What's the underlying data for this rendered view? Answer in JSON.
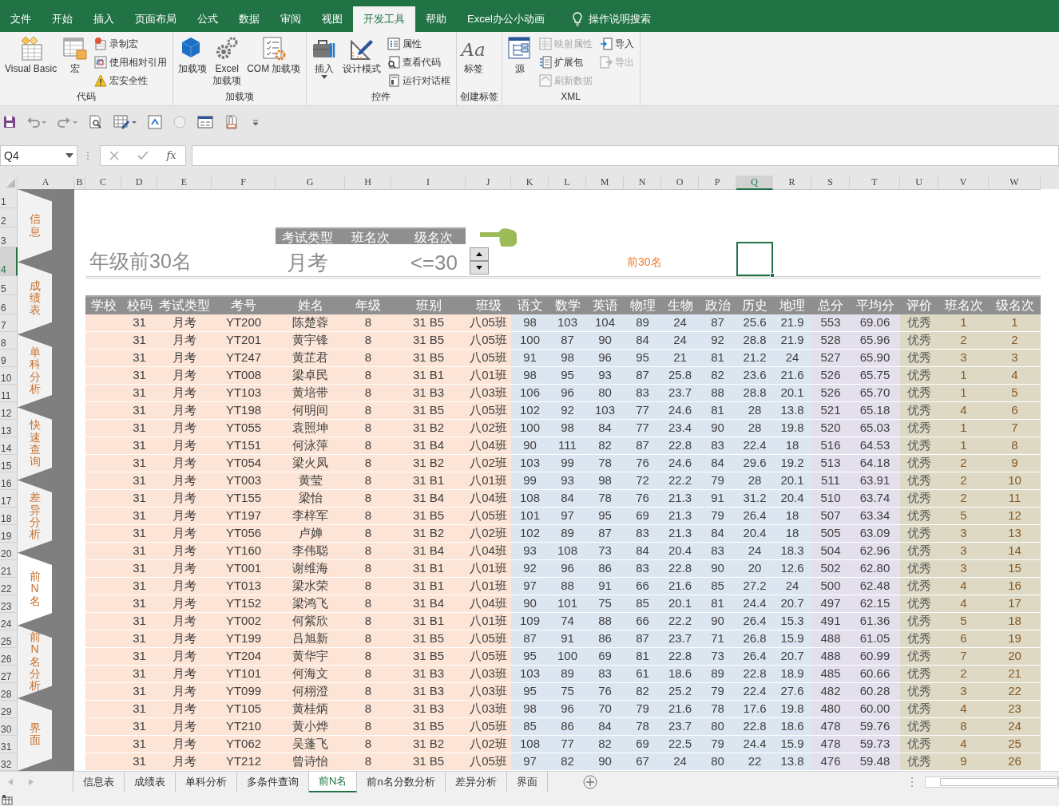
{
  "menu_tabs": [
    {
      "label": "文件",
      "selected": false
    },
    {
      "label": "开始",
      "selected": false
    },
    {
      "label": "插入",
      "selected": false
    },
    {
      "label": "页面布局",
      "selected": false
    },
    {
      "label": "公式",
      "selected": false
    },
    {
      "label": "数据",
      "selected": false
    },
    {
      "label": "审阅",
      "selected": false
    },
    {
      "label": "视图",
      "selected": false
    },
    {
      "label": "开发工具",
      "selected": true
    },
    {
      "label": "帮助",
      "selected": false
    },
    {
      "label": "Excel办公小动画",
      "selected": false
    }
  ],
  "tell_me": "操作说明搜索",
  "ribbon_groups": [
    {
      "title": "代码",
      "buttons": [
        {
          "label": "Visual Basic",
          "kind": "large",
          "disabled": false
        },
        {
          "label": "宏",
          "kind": "large",
          "disabled": false
        },
        {
          "label": "录制宏",
          "kind": "small",
          "disabled": false
        },
        {
          "label": "使用相对引用",
          "kind": "small",
          "disabled": false
        },
        {
          "label": "宏安全性",
          "kind": "small",
          "disabled": false
        }
      ]
    },
    {
      "title": "加载项",
      "buttons": [
        {
          "label": "加载项",
          "kind": "large",
          "disabled": false
        },
        {
          "label": "Excel\n加载项",
          "kind": "large",
          "disabled": false
        },
        {
          "label": "COM 加载项",
          "kind": "large",
          "disabled": false
        }
      ]
    },
    {
      "title": "控件",
      "buttons": [
        {
          "label": "插入",
          "kind": "large-menu",
          "disabled": false
        },
        {
          "label": "设计模式",
          "kind": "large",
          "disabled": false
        },
        {
          "label": "属性",
          "kind": "small",
          "disabled": false
        },
        {
          "label": "查看代码",
          "kind": "small",
          "disabled": false
        },
        {
          "label": "运行对话框",
          "kind": "small",
          "disabled": false
        }
      ]
    },
    {
      "title": "创建标签",
      "buttons": [
        {
          "label": "标签",
          "kind": "large",
          "glyph": "Aa",
          "disabled": false
        }
      ]
    },
    {
      "title": "XML",
      "buttons": [
        {
          "label": "源",
          "kind": "large",
          "disabled": false
        },
        {
          "label": "映射属性",
          "kind": "small",
          "disabled": true
        },
        {
          "label": "扩展包",
          "kind": "small",
          "disabled": false
        },
        {
          "label": "刷新数据",
          "kind": "small",
          "disabled": true
        },
        {
          "label": "导入",
          "kind": "small",
          "disabled": false
        },
        {
          "label": "导出",
          "kind": "small",
          "disabled": true
        }
      ]
    }
  ],
  "formula_bar": {
    "name_box": "Q4",
    "fx": "fx"
  },
  "columns": [
    {
      "label": "A",
      "selected": false
    },
    {
      "label": "B",
      "selected": false
    },
    {
      "label": "C",
      "selected": false
    },
    {
      "label": "D",
      "selected": false
    },
    {
      "label": "E",
      "selected": false
    },
    {
      "label": "F",
      "selected": false
    },
    {
      "label": "G",
      "selected": false
    },
    {
      "label": "H",
      "selected": false
    },
    {
      "label": "I",
      "selected": false
    },
    {
      "label": "J",
      "selected": false
    },
    {
      "label": "K",
      "selected": false
    },
    {
      "label": "L",
      "selected": false
    },
    {
      "label": "M",
      "selected": false
    },
    {
      "label": "N",
      "selected": false
    },
    {
      "label": "O",
      "selected": false
    },
    {
      "label": "P",
      "selected": false
    },
    {
      "label": "Q",
      "selected": true
    },
    {
      "label": "R",
      "selected": false
    },
    {
      "label": "S",
      "selected": false
    },
    {
      "label": "T",
      "selected": false
    },
    {
      "label": "U",
      "selected": false
    },
    {
      "label": "V",
      "selected": false
    },
    {
      "label": "W",
      "selected": false
    }
  ],
  "row_numbers": [
    {
      "label": "1",
      "selected": false
    },
    {
      "label": "2",
      "selected": false
    },
    {
      "label": "3",
      "selected": false
    },
    {
      "label": "4",
      "selected": true
    },
    {
      "label": "5",
      "selected": false
    },
    {
      "label": "6",
      "selected": false
    },
    {
      "label": "7",
      "selected": false
    },
    {
      "label": "8",
      "selected": false
    },
    {
      "label": "9",
      "selected": false
    },
    {
      "label": "10",
      "selected": false
    },
    {
      "label": "11",
      "selected": false
    },
    {
      "label": "12",
      "selected": false
    },
    {
      "label": "13",
      "selected": false
    },
    {
      "label": "14",
      "selected": false
    },
    {
      "label": "15",
      "selected": false
    },
    {
      "label": "16",
      "selected": false
    },
    {
      "label": "17",
      "selected": false
    },
    {
      "label": "18",
      "selected": false
    },
    {
      "label": "19",
      "selected": false
    },
    {
      "label": "20",
      "selected": false
    },
    {
      "label": "21",
      "selected": false
    },
    {
      "label": "22",
      "selected": false
    },
    {
      "label": "23",
      "selected": false
    },
    {
      "label": "24",
      "selected": false
    },
    {
      "label": "25",
      "selected": false
    },
    {
      "label": "26",
      "selected": false
    },
    {
      "label": "27",
      "selected": false
    },
    {
      "label": "28",
      "selected": false
    },
    {
      "label": "29",
      "selected": false
    },
    {
      "label": "30",
      "selected": false
    },
    {
      "label": "31",
      "selected": false
    },
    {
      "label": "32",
      "selected": false
    }
  ],
  "side_nav": [
    {
      "label": "信息",
      "selected": false
    },
    {
      "label": "成绩表",
      "selected": false
    },
    {
      "label": "单科分析",
      "selected": false
    },
    {
      "label": "快速查询",
      "selected": false
    },
    {
      "label": "差异分析",
      "selected": false
    },
    {
      "label": "前N名",
      "selected": true
    },
    {
      "label": "前N名分析",
      "selected": false
    },
    {
      "label": "界面",
      "selected": false
    }
  ],
  "panel": {
    "title": "年级前30名",
    "criteria": [
      {
        "header": "考试类型",
        "value": "月考"
      },
      {
        "header": "班名次"
      },
      {
        "header": "级名次",
        "value": "<=30"
      }
    ],
    "result": "前30名"
  },
  "table": {
    "columns": [
      "学校",
      "校码",
      "考试类型",
      "考号",
      "姓名",
      "年级",
      "班别",
      "班级",
      "语文",
      "数学",
      "英语",
      "物理",
      "生物",
      "政治",
      "历史",
      "地理",
      "总分",
      "平均分",
      "评价",
      "班名次",
      "级名次"
    ],
    "rows": [
      [
        "",
        "31",
        "月考",
        "YT200",
        "陈楚蓉",
        "8",
        "31 B5",
        "八05班",
        "98",
        "103",
        "104",
        "89",
        "24",
        "87",
        "25.6",
        "21.9",
        "553",
        "69.06",
        "优秀",
        "1",
        "1"
      ],
      [
        "",
        "31",
        "月考",
        "YT201",
        "黄宇锋",
        "8",
        "31 B5",
        "八05班",
        "100",
        "87",
        "90",
        "84",
        "24",
        "92",
        "28.8",
        "21.9",
        "528",
        "65.96",
        "优秀",
        "2",
        "2"
      ],
      [
        "",
        "31",
        "月考",
        "YT247",
        "黄芷君",
        "8",
        "31 B5",
        "八05班",
        "91",
        "98",
        "96",
        "95",
        "21",
        "81",
        "21.2",
        "24",
        "527",
        "65.90",
        "优秀",
        "3",
        "3"
      ],
      [
        "",
        "31",
        "月考",
        "YT008",
        "梁卓民",
        "8",
        "31 B1",
        "八01班",
        "98",
        "95",
        "93",
        "87",
        "25.8",
        "82",
        "23.6",
        "21.6",
        "526",
        "65.75",
        "优秀",
        "1",
        "4"
      ],
      [
        "",
        "31",
        "月考",
        "YT103",
        "黄培带",
        "8",
        "31 B3",
        "八03班",
        "106",
        "96",
        "80",
        "83",
        "23.7",
        "88",
        "28.8",
        "20.1",
        "526",
        "65.70",
        "优秀",
        "1",
        "5"
      ],
      [
        "",
        "31",
        "月考",
        "YT198",
        "何明间",
        "8",
        "31 B5",
        "八05班",
        "102",
        "92",
        "103",
        "77",
        "24.6",
        "81",
        "28",
        "13.8",
        "521",
        "65.18",
        "优秀",
        "4",
        "6"
      ],
      [
        "",
        "31",
        "月考",
        "YT055",
        "袁照坤",
        "8",
        "31 B2",
        "八02班",
        "100",
        "98",
        "84",
        "77",
        "23.4",
        "90",
        "28",
        "19.8",
        "520",
        "65.03",
        "优秀",
        "1",
        "7"
      ],
      [
        "",
        "31",
        "月考",
        "YT151",
        "何泳萍",
        "8",
        "31 B4",
        "八04班",
        "90",
        "111",
        "82",
        "87",
        "22.8",
        "83",
        "22.4",
        "18",
        "516",
        "64.53",
        "优秀",
        "1",
        "8"
      ],
      [
        "",
        "31",
        "月考",
        "YT054",
        "梁火凤",
        "8",
        "31 B2",
        "八02班",
        "103",
        "99",
        "78",
        "76",
        "24.6",
        "84",
        "29.6",
        "19.2",
        "513",
        "64.18",
        "优秀",
        "2",
        "9"
      ],
      [
        "",
        "31",
        "月考",
        "YT003",
        "黄莹",
        "8",
        "31 B1",
        "八01班",
        "99",
        "93",
        "98",
        "72",
        "22.2",
        "79",
        "28",
        "20.1",
        "511",
        "63.91",
        "优秀",
        "2",
        "10"
      ],
      [
        "",
        "31",
        "月考",
        "YT155",
        "梁怡",
        "8",
        "31 B4",
        "八04班",
        "108",
        "84",
        "78",
        "76",
        "21.3",
        "91",
        "31.2",
        "20.4",
        "510",
        "63.74",
        "优秀",
        "2",
        "11"
      ],
      [
        "",
        "31",
        "月考",
        "YT197",
        "李梓军",
        "8",
        "31 B5",
        "八05班",
        "101",
        "97",
        "95",
        "69",
        "21.3",
        "79",
        "26.4",
        "18",
        "507",
        "63.34",
        "优秀",
        "5",
        "12"
      ],
      [
        "",
        "31",
        "月考",
        "YT056",
        "卢婵",
        "8",
        "31 B2",
        "八02班",
        "102",
        "89",
        "87",
        "83",
        "21.3",
        "84",
        "20.4",
        "18",
        "505",
        "63.09",
        "优秀",
        "3",
        "13"
      ],
      [
        "",
        "31",
        "月考",
        "YT160",
        "李伟聪",
        "8",
        "31 B4",
        "八04班",
        "93",
        "108",
        "73",
        "84",
        "20.4",
        "83",
        "24",
        "18.3",
        "504",
        "62.96",
        "优秀",
        "3",
        "14"
      ],
      [
        "",
        "31",
        "月考",
        "YT001",
        "谢维海",
        "8",
        "31 B1",
        "八01班",
        "92",
        "96",
        "86",
        "83",
        "22.8",
        "90",
        "20",
        "12.6",
        "502",
        "62.80",
        "优秀",
        "3",
        "15"
      ],
      [
        "",
        "31",
        "月考",
        "YT013",
        "梁水荣",
        "8",
        "31 B1",
        "八01班",
        "97",
        "88",
        "91",
        "66",
        "21.6",
        "85",
        "27.2",
        "24",
        "500",
        "62.48",
        "优秀",
        "4",
        "16"
      ],
      [
        "",
        "31",
        "月考",
        "YT152",
        "梁鸿飞",
        "8",
        "31 B4",
        "八04班",
        "90",
        "101",
        "75",
        "85",
        "20.1",
        "81",
        "24.4",
        "20.7",
        "497",
        "62.15",
        "优秀",
        "4",
        "17"
      ],
      [
        "",
        "31",
        "月考",
        "YT002",
        "何紫欣",
        "8",
        "31 B1",
        "八01班",
        "109",
        "74",
        "88",
        "66",
        "22.2",
        "90",
        "26.4",
        "15.3",
        "491",
        "61.36",
        "优秀",
        "5",
        "18"
      ],
      [
        "",
        "31",
        "月考",
        "YT199",
        "吕旭新",
        "8",
        "31 B5",
        "八05班",
        "87",
        "91",
        "86",
        "87",
        "23.7",
        "71",
        "26.8",
        "15.9",
        "488",
        "61.05",
        "优秀",
        "6",
        "19"
      ],
      [
        "",
        "31",
        "月考",
        "YT204",
        "黄华宇",
        "8",
        "31 B5",
        "八05班",
        "95",
        "100",
        "69",
        "81",
        "22.8",
        "73",
        "26.4",
        "20.7",
        "488",
        "60.99",
        "优秀",
        "7",
        "20"
      ],
      [
        "",
        "31",
        "月考",
        "YT101",
        "何海文",
        "8",
        "31 B3",
        "八03班",
        "103",
        "89",
        "83",
        "61",
        "18.6",
        "89",
        "22.8",
        "18.9",
        "485",
        "60.66",
        "优秀",
        "2",
        "21"
      ],
      [
        "",
        "31",
        "月考",
        "YT099",
        "何栩澄",
        "8",
        "31 B3",
        "八03班",
        "95",
        "75",
        "76",
        "82",
        "25.2",
        "79",
        "22.4",
        "27.6",
        "482",
        "60.28",
        "优秀",
        "3",
        "22"
      ],
      [
        "",
        "31",
        "月考",
        "YT105",
        "黄桂炳",
        "8",
        "31 B3",
        "八03班",
        "98",
        "96",
        "70",
        "79",
        "21.6",
        "78",
        "17.6",
        "19.8",
        "480",
        "60.00",
        "优秀",
        "4",
        "23"
      ],
      [
        "",
        "31",
        "月考",
        "YT210",
        "黄小烨",
        "8",
        "31 B5",
        "八05班",
        "85",
        "86",
        "84",
        "78",
        "23.7",
        "80",
        "22.8",
        "18.6",
        "478",
        "59.76",
        "优秀",
        "8",
        "24"
      ],
      [
        "",
        "31",
        "月考",
        "YT062",
        "吴蓬飞",
        "8",
        "31 B2",
        "八02班",
        "108",
        "77",
        "82",
        "69",
        "22.5",
        "79",
        "24.4",
        "15.9",
        "478",
        "59.73",
        "优秀",
        "4",
        "25"
      ],
      [
        "",
        "31",
        "月考",
        "YT212",
        "曾诗怡",
        "8",
        "31 B5",
        "八05班",
        "97",
        "82",
        "90",
        "67",
        "24",
        "80",
        "22",
        "13.8",
        "476",
        "59.48",
        "优秀",
        "9",
        "26"
      ]
    ]
  },
  "sheet_tabs": [
    {
      "label": "信息表",
      "selected": false
    },
    {
      "label": "成绩表",
      "selected": false
    },
    {
      "label": "单科分析",
      "selected": false
    },
    {
      "label": "多条件查询",
      "selected": false
    },
    {
      "label": "前N名",
      "selected": true
    },
    {
      "label": "前n名分数分析",
      "selected": false
    },
    {
      "label": "差异分析",
      "selected": false
    },
    {
      "label": "界面",
      "selected": false
    }
  ]
}
